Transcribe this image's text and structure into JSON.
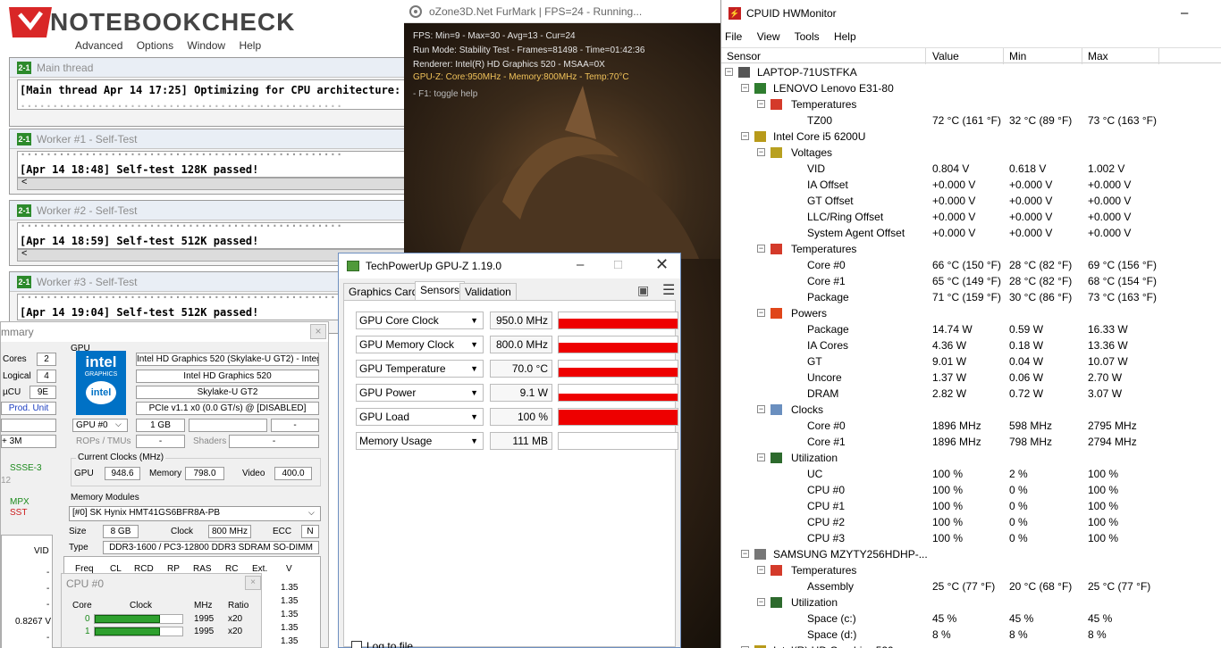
{
  "prime95": {
    "logo": "NOTEBOOKCHECK",
    "menu": [
      "Advanced",
      "Options",
      "Window",
      "Help"
    ],
    "windows": [
      {
        "title": "Main thread",
        "line": "[Main thread Apr 14 17:25] Optimizing for CPU architecture: Unknow"
      },
      {
        "title": "Worker #1 - Self-Test",
        "line": "[Apr 14 18:48] Self-test 128K passed!"
      },
      {
        "title": "Worker #2 - Self-Test",
        "line": "[Apr 14 18:59] Self-test 512K passed!"
      },
      {
        "title": "Worker #3 - Self-Test",
        "line": "[Apr 14 19:04] Self-test 512K passed!"
      }
    ]
  },
  "furmark": {
    "title": "oZone3D.Net FurMark | FPS=24 - Running...",
    "lines": [
      "FPS: Min=9 - Max=30 - Avg=13 - Cur=24",
      "Run Mode: Stability Test - Frames=81498 - Time=01:42:36",
      "Renderer: Intel(R) HD Graphics 520 - MSAA=0X"
    ],
    "gpu_line": "GPU-Z: Core:950MHz - Memory:800MHz - Temp:70°C",
    "help": "- F1: toggle help"
  },
  "summary": {
    "title": "mmary",
    "close": "×",
    "cores_label": "Cores",
    "cores": "2",
    "logical_label": "Logical",
    "logical": "4",
    "ucu_label": "µCU",
    "ucu": "9E",
    "prod_unit": "Prod. Unit",
    "plus3m": "+ 3M",
    "ssse3": "SSSE-3",
    "n12": "12",
    "mpx": "MPX",
    "sst": "SST",
    "vid_label": "VID",
    "dashes": [
      "-",
      "-",
      "-",
      "-"
    ],
    "vid_value": "0.8267 V",
    "dash_last": "-",
    "gpu_label": "GPU",
    "intel_logo": "intel",
    "intel_sub": "GRAPHICS",
    "intel_ring": "intel",
    "gpu_name": "Intel HD Graphics 520 (Skylake-U GT2) - Integ",
    "gpu_short": "Intel HD Graphics 520",
    "gpu_codename": "Skylake-U GT2",
    "pcie": "PCIe v1.1 x0 (0.0 GT/s) @ [DISABLED]",
    "gpu_select": "GPU #0",
    "vram": "1 GB",
    "dash": "-",
    "rops_label": "ROPs / TMUs",
    "shaders_label": "Shaders",
    "clocks_group": "Current Clocks (MHz)",
    "clk_gpu_label": "GPU",
    "clk_gpu": "948.6",
    "clk_mem_label": "Memory",
    "clk_mem": "798.0",
    "clk_vid_label": "Video",
    "clk_vid": "400.0",
    "mem_group": "Memory Modules",
    "module": "[#0] SK Hynix HMT41GS6BFR8A-PB",
    "size_label": "Size",
    "size": "8 GB",
    "clock_label": "Clock",
    "clock": "800 MHz",
    "ecc_label": "ECC",
    "ecc": "N",
    "type_label": "Type",
    "type": "DDR3-1600 / PC3-12800 DDR3 SDRAM SO-DIMM",
    "timings": [
      "Freq",
      "CL",
      "RCD",
      "RP",
      "RAS",
      "RC",
      "Ext.",
      "V"
    ],
    "volts": [
      "1.35",
      "1.35",
      "1.35",
      "1.35",
      "1.35",
      "1.35"
    ]
  },
  "cpu0": {
    "title": "CPU #0",
    "cols": [
      "Core",
      "Clock",
      "MHz",
      "Ratio"
    ],
    "rows": [
      {
        "core": "0",
        "mhz": "1995",
        "ratio": "x20",
        "fill": 0.74
      },
      {
        "core": "1",
        "mhz": "1995",
        "ratio": "x20",
        "fill": 0.74
      }
    ]
  },
  "gpuz": {
    "title": "TechPowerUp GPU-Z 1.19.0",
    "tabs": [
      "Graphics Card",
      "Sensors",
      "Validation"
    ],
    "log": "Log to file",
    "sensors": [
      {
        "name": "GPU Core Clock",
        "value": "950.0 MHz",
        "fill": 0.55
      },
      {
        "name": "GPU Memory Clock",
        "value": "800.0 MHz",
        "fill": 0.55
      },
      {
        "name": "GPU Temperature",
        "value": "70.0 °C",
        "fill": 0.5
      },
      {
        "name": "GPU Power",
        "value": "9.1 W",
        "fill": 0.4
      },
      {
        "name": "GPU Load",
        "value": "100 %",
        "fill": 0.85
      },
      {
        "name": "Memory Usage",
        "value": "111 MB",
        "fill": 0
      }
    ]
  },
  "hwmonitor": {
    "title": "CPUID HWMonitor",
    "menu": [
      "File",
      "View",
      "Tools",
      "Help"
    ],
    "columns": [
      "Sensor",
      "Value",
      "Min",
      "Max"
    ],
    "rows": [
      {
        "level": 0,
        "kind": "pc",
        "name": "LAPTOP-71USTFKA"
      },
      {
        "level": 1,
        "kind": "board",
        "name": "LENOVO Lenovo E31-80"
      },
      {
        "level": 2,
        "kind": "temp",
        "name": "Temperatures"
      },
      {
        "level": 3,
        "name": "TZ00",
        "value": "72 °C  (161 °F)",
        "min": "32 °C  (89 °F)",
        "max": "73 °C  (163 °F)"
      },
      {
        "level": 1,
        "kind": "chip",
        "name": "Intel Core i5 6200U"
      },
      {
        "level": 2,
        "kind": "volt",
        "name": "Voltages"
      },
      {
        "level": 3,
        "name": "VID",
        "value": "0.804 V",
        "min": "0.618 V",
        "max": "1.002 V"
      },
      {
        "level": 3,
        "name": "IA Offset",
        "value": "+0.000 V",
        "min": "+0.000 V",
        "max": "+0.000 V"
      },
      {
        "level": 3,
        "name": "GT Offset",
        "value": "+0.000 V",
        "min": "+0.000 V",
        "max": "+0.000 V"
      },
      {
        "level": 3,
        "name": "LLC/Ring Offset",
        "value": "+0.000 V",
        "min": "+0.000 V",
        "max": "+0.000 V"
      },
      {
        "level": 3,
        "name": "System Agent Offset",
        "value": "+0.000 V",
        "min": "+0.000 V",
        "max": "+0.000 V"
      },
      {
        "level": 2,
        "kind": "temp",
        "name": "Temperatures"
      },
      {
        "level": 3,
        "name": "Core #0",
        "value": "66 °C  (150 °F)",
        "min": "28 °C  (82 °F)",
        "max": "69 °C  (156 °F)"
      },
      {
        "level": 3,
        "name": "Core #1",
        "value": "65 °C  (149 °F)",
        "min": "28 °C  (82 °F)",
        "max": "68 °C  (154 °F)"
      },
      {
        "level": 3,
        "name": "Package",
        "value": "71 °C  (159 °F)",
        "min": "30 °C  (86 °F)",
        "max": "73 °C  (163 °F)"
      },
      {
        "level": 2,
        "kind": "power",
        "name": "Powers"
      },
      {
        "level": 3,
        "name": "Package",
        "value": "14.74 W",
        "min": "0.59 W",
        "max": "16.33 W"
      },
      {
        "level": 3,
        "name": "IA Cores",
        "value": "4.36 W",
        "min": "0.18 W",
        "max": "13.36 W"
      },
      {
        "level": 3,
        "name": "GT",
        "value": "9.01 W",
        "min": "0.04 W",
        "max": "10.07 W"
      },
      {
        "level": 3,
        "name": "Uncore",
        "value": "1.37 W",
        "min": "0.06 W",
        "max": "2.70 W"
      },
      {
        "level": 3,
        "name": "DRAM",
        "value": "2.82 W",
        "min": "0.72 W",
        "max": "3.07 W"
      },
      {
        "level": 2,
        "kind": "clock",
        "name": "Clocks"
      },
      {
        "level": 3,
        "name": "Core #0",
        "value": "1896 MHz",
        "min": "598 MHz",
        "max": "2795 MHz"
      },
      {
        "level": 3,
        "name": "Core #1",
        "value": "1896 MHz",
        "min": "798 MHz",
        "max": "2794 MHz"
      },
      {
        "level": 2,
        "kind": "util",
        "name": "Utilization"
      },
      {
        "level": 3,
        "name": "UC",
        "value": "100 %",
        "min": "2 %",
        "max": "100 %"
      },
      {
        "level": 3,
        "name": "CPU #0",
        "value": "100 %",
        "min": "0 %",
        "max": "100 %"
      },
      {
        "level": 3,
        "name": "CPU #1",
        "value": "100 %",
        "min": "0 %",
        "max": "100 %"
      },
      {
        "level": 3,
        "name": "CPU #2",
        "value": "100 %",
        "min": "0 %",
        "max": "100 %"
      },
      {
        "level": 3,
        "name": "CPU #3",
        "value": "100 %",
        "min": "0 %",
        "max": "100 %"
      },
      {
        "level": 1,
        "kind": "disk",
        "name": "SAMSUNG MZYTY256HDHP-..."
      },
      {
        "level": 2,
        "kind": "temp",
        "name": "Temperatures"
      },
      {
        "level": 3,
        "name": "Assembly",
        "value": "25 °C  (77 °F)",
        "min": "20 °C  (68 °F)",
        "max": "25 °C  (77 °F)"
      },
      {
        "level": 2,
        "kind": "util",
        "name": "Utilization"
      },
      {
        "level": 3,
        "name": "Space (c:)",
        "value": "45 %",
        "min": "45 %",
        "max": "45 %"
      },
      {
        "level": 3,
        "name": "Space (d:)",
        "value": "8 %",
        "min": "8 %",
        "max": "8 %"
      },
      {
        "level": 1,
        "kind": "chip",
        "name": "Intel(R) HD Graphics 520"
      }
    ]
  }
}
